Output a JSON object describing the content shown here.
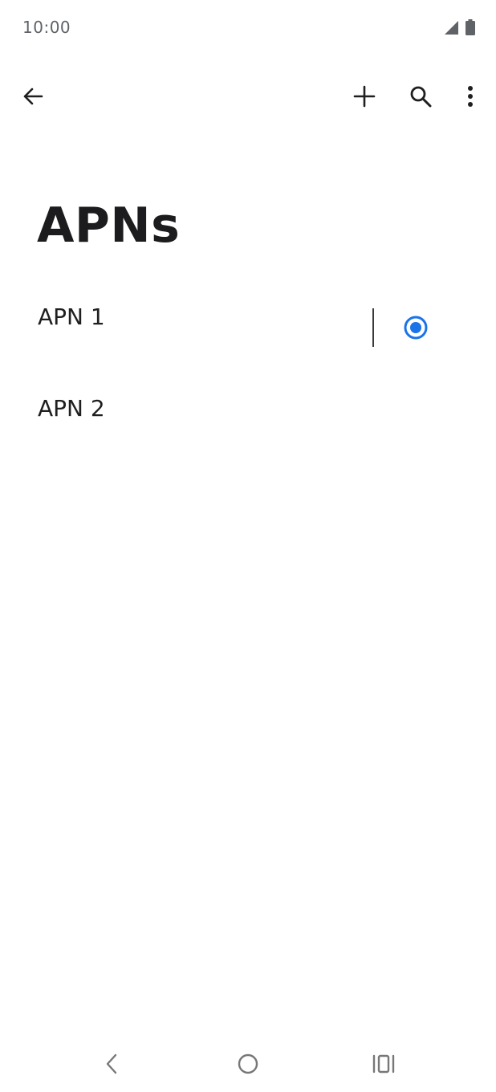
{
  "status_bar": {
    "time": "10:00",
    "icons": [
      "signal-icon",
      "battery-icon"
    ]
  },
  "app_bar": {
    "icons": [
      "back-arrow-icon",
      "add-icon",
      "search-icon",
      "more-vert-icon"
    ]
  },
  "page": {
    "title": "APNs"
  },
  "apn_list": [
    {
      "label": "APN 1",
      "selected": true
    },
    {
      "label": "APN 2",
      "selected": false
    }
  ],
  "nav_bar": {
    "icons": [
      "nav-back-icon",
      "nav-home-icon",
      "nav-recents-icon"
    ]
  },
  "colors": {
    "accent": "#1a73e8",
    "text_primary": "#1f1f1f",
    "text_secondary": "#5f6368"
  }
}
